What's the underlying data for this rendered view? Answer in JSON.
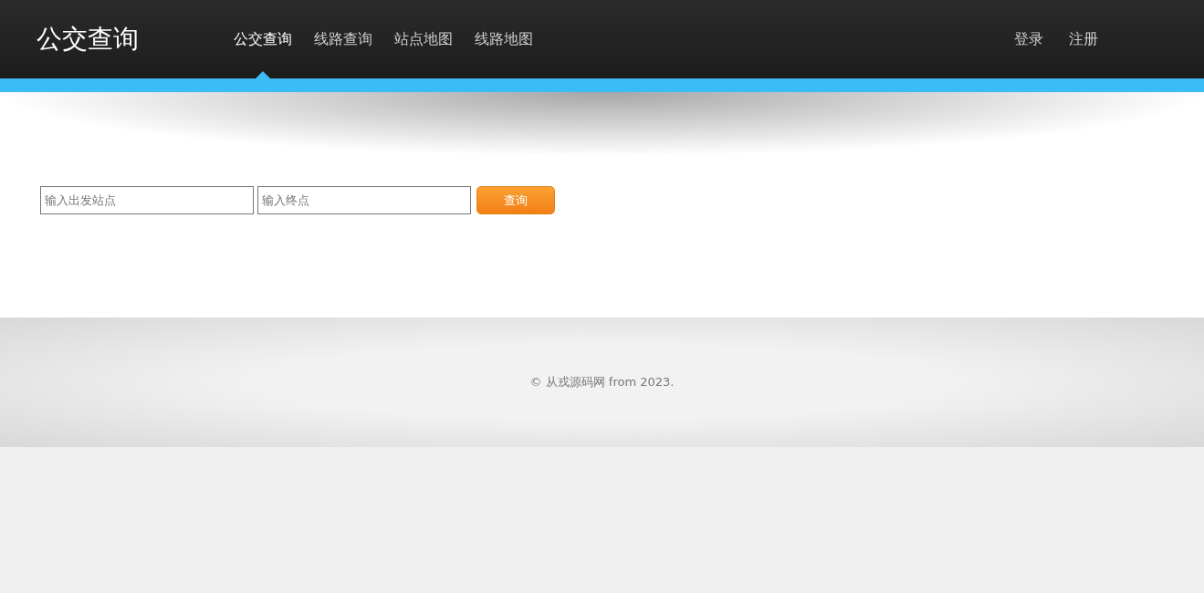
{
  "brand": "公交查询",
  "nav": [
    {
      "label": "公交查询",
      "selected": true
    },
    {
      "label": "线路查询",
      "selected": false
    },
    {
      "label": "站点地图",
      "selected": false
    },
    {
      "label": "线路地图",
      "selected": false
    }
  ],
  "account_links": [
    "登录",
    "注册"
  ],
  "search": {
    "from": {
      "placeholder": "输入出发站点"
    },
    "to": {
      "placeholder": "输入终点"
    },
    "button": "查询"
  },
  "footer": "© 从戎源码网 from 2023."
}
